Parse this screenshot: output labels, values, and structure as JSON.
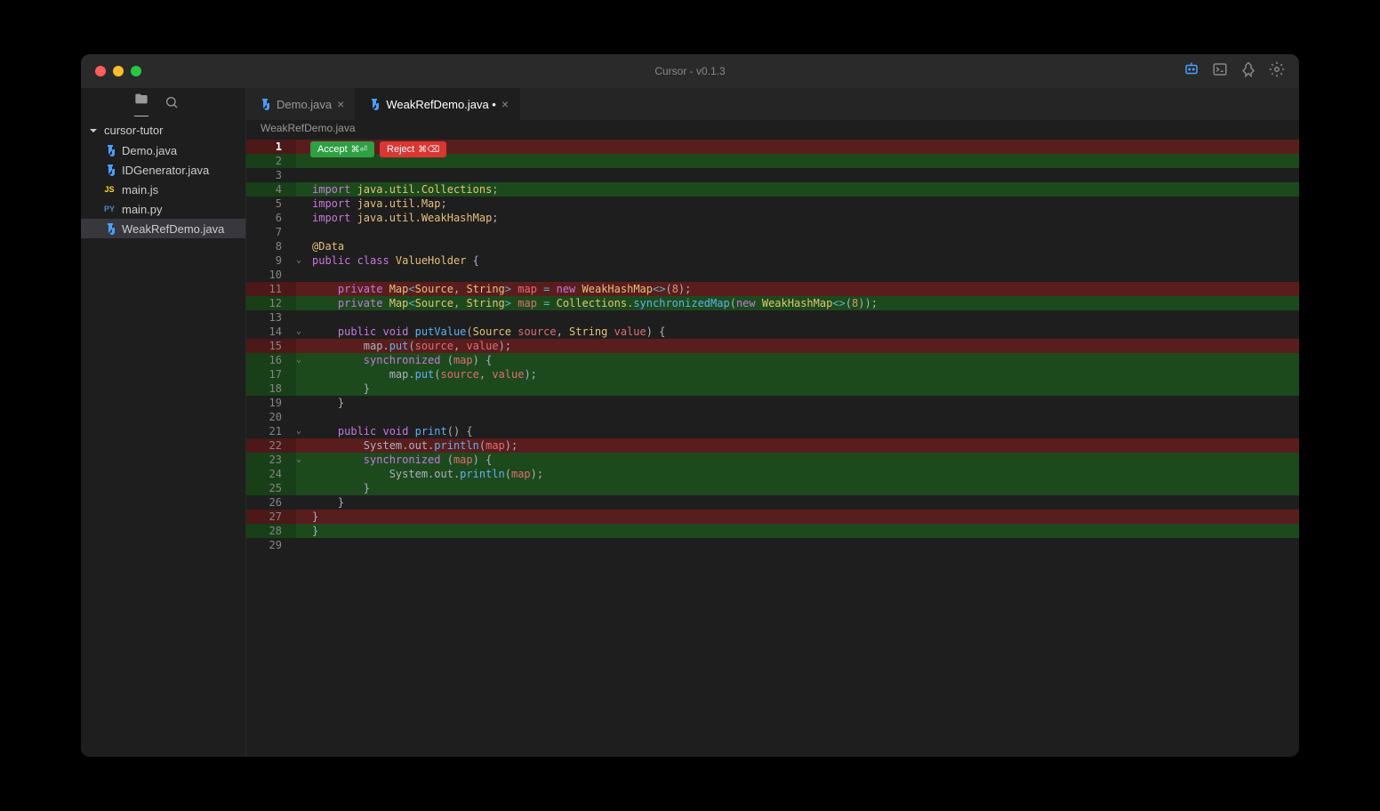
{
  "window_title": "Cursor - v0.1.3",
  "sidebar": {
    "folder": "cursor-tutor",
    "files": [
      {
        "name": "Demo.java",
        "icon": "java"
      },
      {
        "name": "IDGenerator.java",
        "icon": "java"
      },
      {
        "name": "main.js",
        "icon": "js",
        "iconText": "JS"
      },
      {
        "name": "main.py",
        "icon": "py",
        "iconText": "PY"
      },
      {
        "name": "WeakRefDemo.java",
        "icon": "java",
        "active": true
      }
    ]
  },
  "tabs": [
    {
      "name": "Demo.java",
      "active": false,
      "dirty": false
    },
    {
      "name": "WeakRefDemo.java",
      "active": true,
      "dirty": true
    }
  ],
  "breadcrumb": "WeakRefDemo.java",
  "actions": {
    "accept": "Accept",
    "accept_key": "⌘⏎",
    "reject": "Reject",
    "reject_key": "⌘⌫"
  },
  "lines": [
    {
      "n": 1,
      "diff": "del",
      "bold": true,
      "tokens": []
    },
    {
      "n": 2,
      "diff": "add",
      "tokens": []
    },
    {
      "n": 3,
      "tokens": []
    },
    {
      "n": 4,
      "diff": "add",
      "tokens": [
        {
          "t": "import ",
          "c": "kw"
        },
        {
          "t": "java.util.Collections",
          "c": "type"
        },
        {
          "t": ";",
          "c": "p"
        }
      ]
    },
    {
      "n": 5,
      "tokens": [
        {
          "t": "import ",
          "c": "kw"
        },
        {
          "t": "java.util.Map",
          "c": "type"
        },
        {
          "t": ";",
          "c": "p"
        }
      ]
    },
    {
      "n": 6,
      "tokens": [
        {
          "t": "import ",
          "c": "kw"
        },
        {
          "t": "java.util.WeakHashMap",
          "c": "type"
        },
        {
          "t": ";",
          "c": "p"
        }
      ]
    },
    {
      "n": 7,
      "tokens": []
    },
    {
      "n": 8,
      "tokens": [
        {
          "t": "@Data",
          "c": "ann"
        }
      ]
    },
    {
      "n": 9,
      "fold": true,
      "tokens": [
        {
          "t": "public class ",
          "c": "kw"
        },
        {
          "t": "ValueHolder ",
          "c": "type"
        },
        {
          "t": "{",
          "c": "p"
        }
      ]
    },
    {
      "n": 10,
      "tokens": []
    },
    {
      "n": 11,
      "diff": "del",
      "tokens": [
        {
          "t": "    ",
          "c": "p"
        },
        {
          "t": "private ",
          "c": "kw"
        },
        {
          "t": "Map",
          "c": "type"
        },
        {
          "t": "<",
          "c": "op"
        },
        {
          "t": "Source",
          "c": "type"
        },
        {
          "t": ", ",
          "c": "p"
        },
        {
          "t": "String",
          "c": "type"
        },
        {
          "t": "> ",
          "c": "op"
        },
        {
          "t": "map ",
          "c": "id"
        },
        {
          "t": "= ",
          "c": "op"
        },
        {
          "t": "new ",
          "c": "kw"
        },
        {
          "t": "WeakHashMap",
          "c": "type"
        },
        {
          "t": "<>",
          "c": "op"
        },
        {
          "t": "(",
          "c": "p"
        },
        {
          "t": "8",
          "c": "num"
        },
        {
          "t": ");",
          "c": "p"
        }
      ]
    },
    {
      "n": 12,
      "diff": "add",
      "tokens": [
        {
          "t": "    ",
          "c": "p"
        },
        {
          "t": "private ",
          "c": "kw"
        },
        {
          "t": "Map",
          "c": "type"
        },
        {
          "t": "<",
          "c": "op"
        },
        {
          "t": "Source",
          "c": "type"
        },
        {
          "t": ", ",
          "c": "p"
        },
        {
          "t": "String",
          "c": "type"
        },
        {
          "t": "> ",
          "c": "op"
        },
        {
          "t": "map ",
          "c": "id"
        },
        {
          "t": "= ",
          "c": "op"
        },
        {
          "t": "Collections",
          "c": "type"
        },
        {
          "t": ".",
          "c": "p"
        },
        {
          "t": "synchronizedMap",
          "c": "fn"
        },
        {
          "t": "(",
          "c": "p"
        },
        {
          "t": "new ",
          "c": "kw"
        },
        {
          "t": "WeakHashMap",
          "c": "type"
        },
        {
          "t": "<>",
          "c": "op"
        },
        {
          "t": "(",
          "c": "p"
        },
        {
          "t": "8",
          "c": "num"
        },
        {
          "t": "));",
          "c": "p"
        }
      ]
    },
    {
      "n": 13,
      "tokens": []
    },
    {
      "n": 14,
      "fold": true,
      "tokens": [
        {
          "t": "    ",
          "c": "p"
        },
        {
          "t": "public ",
          "c": "kw"
        },
        {
          "t": "void ",
          "c": "kw"
        },
        {
          "t": "putValue",
          "c": "fn"
        },
        {
          "t": "(",
          "c": "p"
        },
        {
          "t": "Source ",
          "c": "type"
        },
        {
          "t": "source",
          "c": "id"
        },
        {
          "t": ", ",
          "c": "p"
        },
        {
          "t": "String ",
          "c": "type"
        },
        {
          "t": "value",
          "c": "id"
        },
        {
          "t": ") {",
          "c": "p"
        }
      ]
    },
    {
      "n": 15,
      "diff": "del",
      "tokens": [
        {
          "t": "        map.",
          "c": "p"
        },
        {
          "t": "put",
          "c": "fn"
        },
        {
          "t": "(",
          "c": "p"
        },
        {
          "t": "source",
          "c": "id"
        },
        {
          "t": ", ",
          "c": "p"
        },
        {
          "t": "value",
          "c": "id"
        },
        {
          "t": ");",
          "c": "p"
        }
      ]
    },
    {
      "n": 16,
      "diff": "add",
      "fold": true,
      "tokens": [
        {
          "t": "        ",
          "c": "p"
        },
        {
          "t": "synchronized ",
          "c": "kw"
        },
        {
          "t": "(",
          "c": "p"
        },
        {
          "t": "map",
          "c": "id"
        },
        {
          "t": ") {",
          "c": "p"
        }
      ]
    },
    {
      "n": 17,
      "diff": "add",
      "tokens": [
        {
          "t": "            map.",
          "c": "p"
        },
        {
          "t": "put",
          "c": "fn"
        },
        {
          "t": "(",
          "c": "p"
        },
        {
          "t": "source",
          "c": "id"
        },
        {
          "t": ", ",
          "c": "p"
        },
        {
          "t": "value",
          "c": "id"
        },
        {
          "t": ");",
          "c": "p"
        }
      ]
    },
    {
      "n": 18,
      "diff": "add",
      "tokens": [
        {
          "t": "        }",
          "c": "p"
        }
      ]
    },
    {
      "n": 19,
      "tokens": [
        {
          "t": "    }",
          "c": "p"
        }
      ]
    },
    {
      "n": 20,
      "tokens": []
    },
    {
      "n": 21,
      "fold": true,
      "tokens": [
        {
          "t": "    ",
          "c": "p"
        },
        {
          "t": "public ",
          "c": "kw"
        },
        {
          "t": "void ",
          "c": "kw"
        },
        {
          "t": "print",
          "c": "fn"
        },
        {
          "t": "() {",
          "c": "p"
        }
      ]
    },
    {
      "n": 22,
      "diff": "del",
      "tokens": [
        {
          "t": "        System.out.",
          "c": "p"
        },
        {
          "t": "println",
          "c": "fn"
        },
        {
          "t": "(",
          "c": "p"
        },
        {
          "t": "map",
          "c": "id"
        },
        {
          "t": ");",
          "c": "p"
        }
      ]
    },
    {
      "n": 23,
      "diff": "add",
      "fold": true,
      "tokens": [
        {
          "t": "        ",
          "c": "p"
        },
        {
          "t": "synchronized ",
          "c": "kw"
        },
        {
          "t": "(",
          "c": "p"
        },
        {
          "t": "map",
          "c": "id"
        },
        {
          "t": ") {",
          "c": "p"
        }
      ]
    },
    {
      "n": 24,
      "diff": "add",
      "tokens": [
        {
          "t": "            System.out.",
          "c": "p"
        },
        {
          "t": "println",
          "c": "fn"
        },
        {
          "t": "(",
          "c": "p"
        },
        {
          "t": "map",
          "c": "id"
        },
        {
          "t": ");",
          "c": "p"
        }
      ]
    },
    {
      "n": 25,
      "diff": "add",
      "tokens": [
        {
          "t": "        }",
          "c": "p"
        }
      ]
    },
    {
      "n": 26,
      "tokens": [
        {
          "t": "    }",
          "c": "p"
        }
      ]
    },
    {
      "n": 27,
      "diff": "del",
      "tokens": [
        {
          "t": "}",
          "c": "p"
        }
      ]
    },
    {
      "n": 28,
      "diff": "add",
      "tokens": [
        {
          "t": "}",
          "c": "p"
        }
      ]
    },
    {
      "n": 29,
      "tokens": []
    }
  ]
}
